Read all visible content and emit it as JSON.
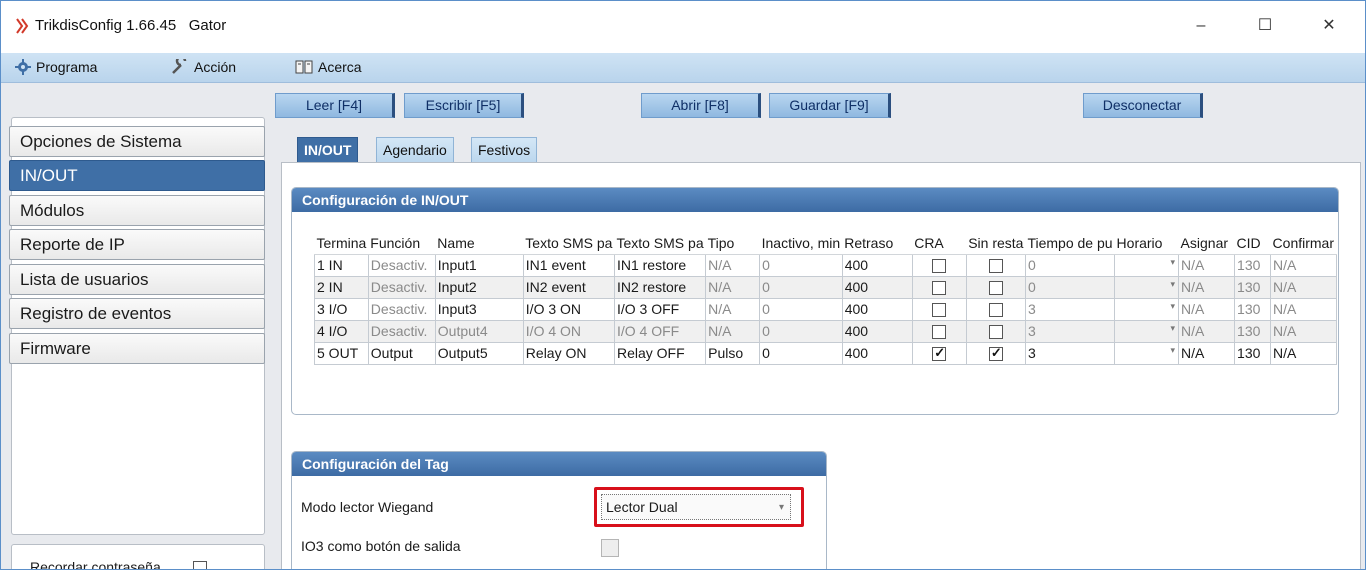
{
  "window": {
    "app_title": "TrikdisConfig 1.66.45",
    "device_name": "Gator",
    "minimize_glyph": "–",
    "maximize_glyph": "☐",
    "close_glyph": "✕"
  },
  "menu": {
    "items": [
      {
        "label": "Programa",
        "icon": "gear-icon"
      },
      {
        "label": "Acción",
        "icon": "wrench-icon"
      },
      {
        "label": "Acerca",
        "icon": "book-icon"
      }
    ]
  },
  "toolbar": {
    "read": "Leer [F4]",
    "write": "Escribir [F5]",
    "open": "Abrir [F8]",
    "save": "Guardar [F9]",
    "disconnect": "Desconectar"
  },
  "sidebar": {
    "items": [
      {
        "label": "Opciones de Sistema",
        "active": false
      },
      {
        "label": "IN/OUT",
        "active": true
      },
      {
        "label": "Módulos",
        "active": false
      },
      {
        "label": "Reporte de IP",
        "active": false
      },
      {
        "label": "Lista de usuarios",
        "active": false
      },
      {
        "label": "Registro de eventos",
        "active": false
      },
      {
        "label": "Firmware",
        "active": false
      }
    ],
    "remember_password": "Recordar contraseña",
    "remember_checked": false
  },
  "tabs": [
    {
      "label": "IN/OUT",
      "active": true
    },
    {
      "label": "Agendario",
      "active": false
    },
    {
      "label": "Festivos",
      "active": false
    }
  ],
  "io_config": {
    "title": "Configuración de IN/OUT",
    "columns": [
      "Termina",
      "Función",
      "Name",
      "Texto SMS pa",
      "Texto SMS pa",
      "Tipo",
      "Inactivo, min",
      "Retraso",
      "CRA",
      "Sin resta",
      "Tiempo de pu",
      "Horario",
      "Asignar",
      "CID",
      "Confirmar"
    ],
    "rows": [
      {
        "terminal": "1 IN",
        "function": "Desactiv.",
        "name": "Input1",
        "sms_on": "IN1 event",
        "sms_off": "IN1 restore",
        "type": "N/A",
        "inactive": "0",
        "delay": "400",
        "cra": false,
        "no_restore": false,
        "pulse": "0",
        "schedule": "",
        "assign": "N/A",
        "cid": "130",
        "confirm": "N/A",
        "enabled": false
      },
      {
        "terminal": "2 IN",
        "function": "Desactiv.",
        "name": "Input2",
        "sms_on": "IN2 event",
        "sms_off": "IN2 restore",
        "type": "N/A",
        "inactive": "0",
        "delay": "400",
        "cra": false,
        "no_restore": false,
        "pulse": "0",
        "schedule": "",
        "assign": "N/A",
        "cid": "130",
        "confirm": "N/A",
        "enabled": false
      },
      {
        "terminal": "3 I/O",
        "function": "Desactiv.",
        "name": "Input3",
        "sms_on": "I/O 3 ON",
        "sms_off": "I/O 3 OFF",
        "type": "N/A",
        "inactive": "0",
        "delay": "400",
        "cra": false,
        "no_restore": false,
        "pulse": "3",
        "schedule": "",
        "assign": "N/A",
        "cid": "130",
        "confirm": "N/A",
        "enabled": false
      },
      {
        "terminal": "4 I/O",
        "function": "Desactiv.",
        "name": "Output4",
        "sms_on": "I/O 4 ON",
        "sms_off": "I/O 4 OFF",
        "type": "N/A",
        "inactive": "0",
        "delay": "400",
        "cra": false,
        "no_restore": false,
        "pulse": "3",
        "schedule": "",
        "assign": "N/A",
        "cid": "130",
        "confirm": "N/A",
        "enabled": false
      },
      {
        "terminal": "5 OUT",
        "function": "Output",
        "name": "Output5",
        "sms_on": "Relay ON",
        "sms_off": "Relay OFF",
        "type": "Pulso",
        "inactive": "0",
        "delay": "400",
        "cra": true,
        "no_restore": true,
        "pulse": "3",
        "schedule": "",
        "assign": "N/A",
        "cid": "130",
        "confirm": "N/A",
        "enabled": true
      }
    ]
  },
  "tag_config": {
    "title": "Configuración del Tag",
    "wiegand_label": "Modo lector Wiegand",
    "wiegand_value": "Lector Dual",
    "io3_exit_label": "IO3 como botón de salida",
    "io3_exit_checked": false
  },
  "colors": {
    "accent": "#3f6fa6",
    "highlight": "#d8101b"
  }
}
